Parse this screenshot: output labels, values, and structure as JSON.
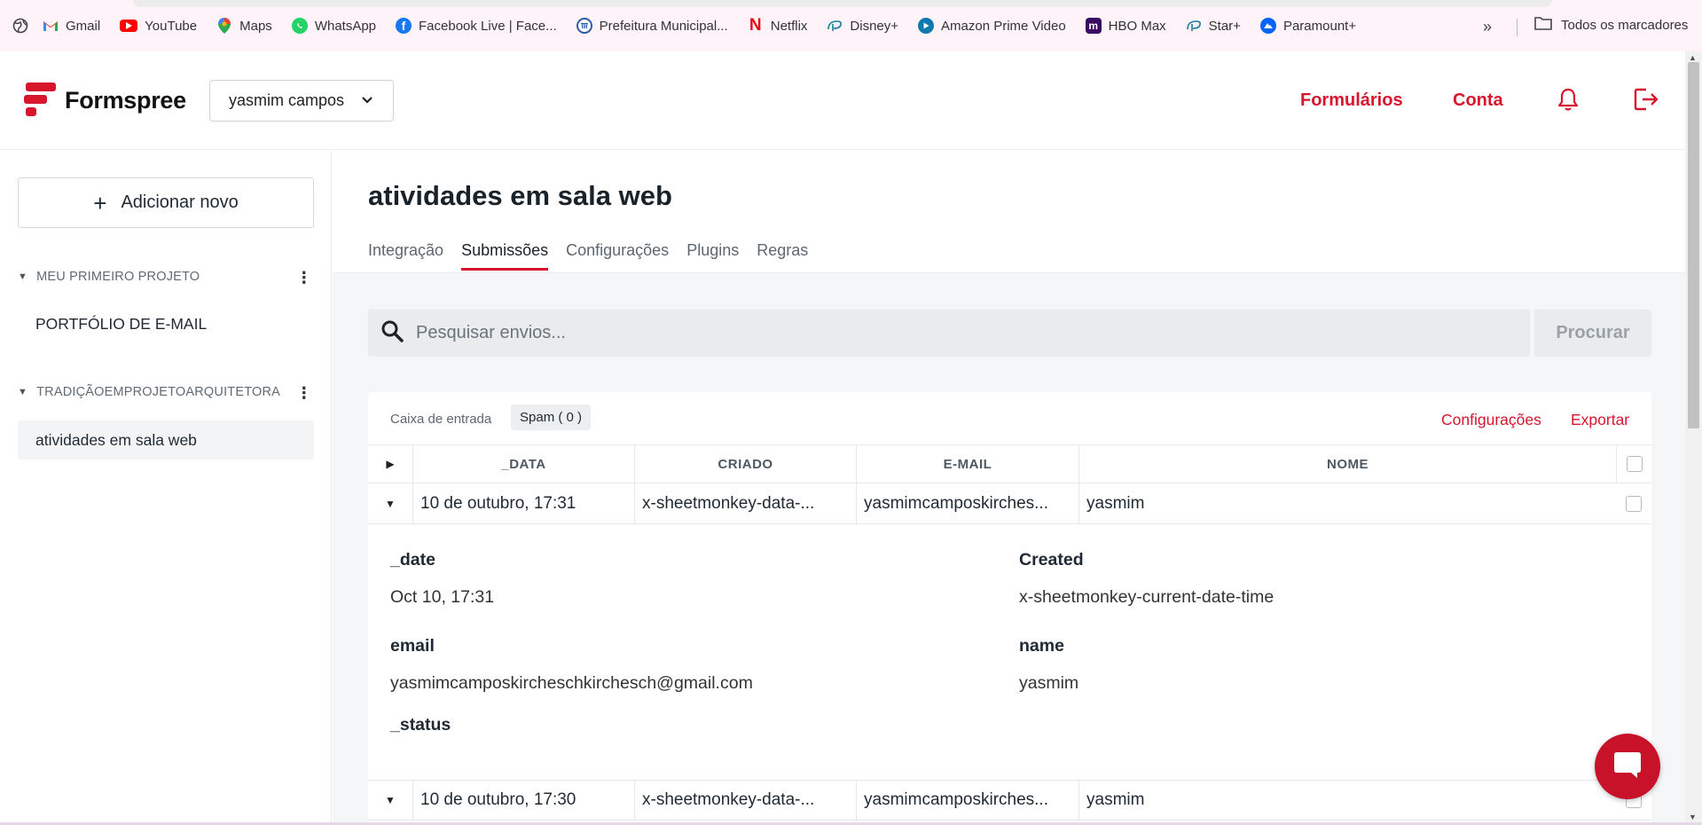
{
  "bookmarks": {
    "items": [
      {
        "label": "Gmail",
        "icon": "gmail-icon",
        "color": "#ea4335"
      },
      {
        "label": "YouTube",
        "icon": "youtube-icon",
        "color": "#ff0000"
      },
      {
        "label": "Maps",
        "icon": "maps-icon",
        "color": "#34a853"
      },
      {
        "label": "WhatsApp",
        "icon": "whatsapp-icon",
        "color": "#25d366"
      },
      {
        "label": "Facebook Live | Face...",
        "icon": "facebook-icon",
        "color": "#1877f2"
      },
      {
        "label": "Prefeitura Municipal...",
        "icon": "prefeitura-icon",
        "color": "#2b5aa8"
      },
      {
        "label": "Netflix",
        "icon": "netflix-icon",
        "color": "#e50914"
      },
      {
        "label": "Disney+",
        "icon": "disney-icon",
        "color": "#1a7f9c"
      },
      {
        "label": "Amazon Prime Video",
        "icon": "prime-video-icon",
        "color": "#1a98ff"
      },
      {
        "label": "HBO Max",
        "icon": "hbo-max-icon",
        "color": "#5b1a8a"
      },
      {
        "label": "Star+",
        "icon": "star-plus-icon",
        "color": "#1a7f9c"
      },
      {
        "label": "Paramount+",
        "icon": "paramount-icon",
        "color": "#0064ff"
      }
    ],
    "all_bookmarks": "Todos os marcadores"
  },
  "header": {
    "brand": "Formspree",
    "account": "yasmim campos",
    "nav": {
      "forms": "Formulários",
      "account": "Conta"
    },
    "accent": "#d7162e"
  },
  "sidebar": {
    "add_new": "Adicionar novo",
    "projects": [
      {
        "name": "MEU PRIMEIRO PROJETO",
        "forms": [
          "PORTFÓLIO DE E-MAIL"
        ]
      },
      {
        "name": "TRADIÇÃOEMPROJETOARQUITETORA",
        "forms": [
          "atividades em sala web"
        ]
      }
    ]
  },
  "main": {
    "title": "atividades em sala web",
    "tabs": [
      "Integração",
      "Submissões",
      "Configurações",
      "Plugins",
      "Regras"
    ],
    "active_tab": "Submissões",
    "search": {
      "placeholder": "Pesquisar envios...",
      "button": "Procurar"
    },
    "panel": {
      "inbox": "Caixa de entrada",
      "spam": "Spam ( 0 )",
      "settings": "Configurações",
      "export": "Exportar"
    },
    "table": {
      "columns": [
        "_DATA",
        "CRIADO",
        "E-MAIL",
        "NOME"
      ],
      "rows": [
        {
          "date": "10 de outubro, 17:31",
          "created": "x-sheetmonkey-data-...",
          "email": "yasmimcamposkirches...",
          "name": "yasmim"
        },
        {
          "date": "10 de outubro, 17:30",
          "created": "x-sheetmonkey-data-...",
          "email": "yasmimcamposkirches...",
          "name": "yasmim"
        }
      ]
    },
    "detail": {
      "date_label": "_date",
      "date_value": "Oct 10, 17:31",
      "created_label": "Created",
      "created_value": "x-sheetmonkey-current-date-time",
      "email_label": "email",
      "email_value": "yasmimcamposkirchesch​kirchesch@gmail.com",
      "name_label": "name",
      "name_value": "yasmim",
      "status_label": "_status"
    }
  }
}
